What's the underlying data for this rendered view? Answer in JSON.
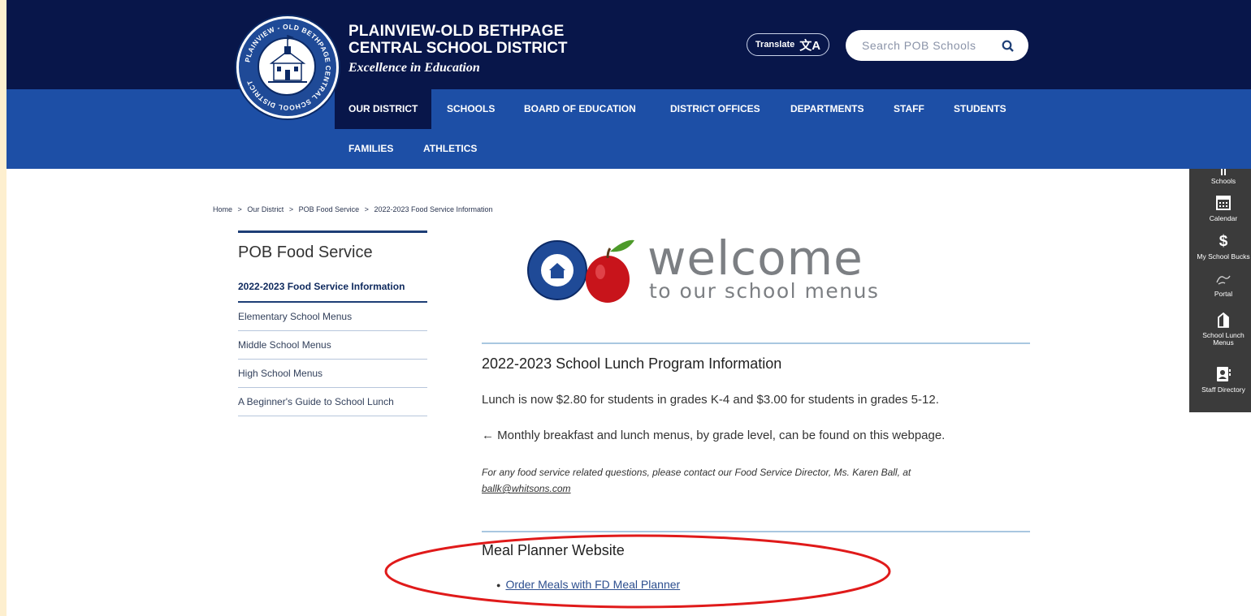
{
  "header": {
    "district_line1": "PLAINVIEW-OLD BETHPAGE",
    "district_line2": "CENTRAL SCHOOL DISTRICT",
    "tagline": "Excellence in Education",
    "seal_text": "PLAINVIEW - OLD BETHPAGE CENTRAL SCHOOL DISTRICT",
    "translate_label": "Translate",
    "search_placeholder": "Search POB Schools"
  },
  "nav": {
    "items": [
      {
        "label": "OUR DISTRICT",
        "active": true
      },
      {
        "label": "SCHOOLS"
      },
      {
        "label": "BOARD OF EDUCATION"
      },
      {
        "label": "DISTRICT OFFICES"
      },
      {
        "label": "DEPARTMENTS"
      },
      {
        "label": "STAFF"
      },
      {
        "label": "STUDENTS"
      },
      {
        "label": "FAMILIES"
      },
      {
        "label": "ATHLETICS"
      }
    ]
  },
  "breadcrumb": [
    "Home",
    "Our District",
    "POB Food Service",
    "2022-2023 Food Service Information"
  ],
  "breadcrumb_sep": ">",
  "sidebar": {
    "heading": "POB Food Service",
    "items": [
      {
        "label": "2022-2023 Food Service Information",
        "active": true
      },
      {
        "label": "Elementary School Menus"
      },
      {
        "label": "Middle School Menus"
      },
      {
        "label": "High School Menus"
      },
      {
        "label": "A Beginner's Guide to School Lunch"
      }
    ]
  },
  "banner": {
    "headline": "welcome",
    "subline": "to our school menus"
  },
  "content": {
    "section1_title": "2022-2023 School Lunch Program Information",
    "price_text": "Lunch is now $2.80 for students in grades K-4 and $3.00 for students in grades 5-12.",
    "menus_text": "←  Monthly breakfast and lunch menus, by grade level, can be found on this webpage.",
    "contact_text": "For any food service related questions, please contact our Food Service Director, Ms. Karen Ball, at",
    "contact_email": "ballk@whitsons.com",
    "section2_title": "Meal Planner Website",
    "meal_link": "Order Meals with FD Meal Planner"
  },
  "quick_links": [
    {
      "label": "Schools",
      "icon": "school-icon"
    },
    {
      "label": "Calendar",
      "icon": "calendar-icon"
    },
    {
      "label": "My School Bucks",
      "icon": "dollar-icon"
    },
    {
      "label": "Portal",
      "icon": "portal-icon"
    },
    {
      "label": "School Lunch Menus",
      "icon": "milk-carton-icon"
    },
    {
      "label": "Staff Directory",
      "icon": "contact-card-icon"
    }
  ],
  "colors": {
    "header_dark": "#08164a",
    "nav_blue": "#1d4fa6",
    "highlight_ellipse": "#e01a1a",
    "page_frame": "#fdefcf",
    "rail": "#3b3b3b"
  }
}
